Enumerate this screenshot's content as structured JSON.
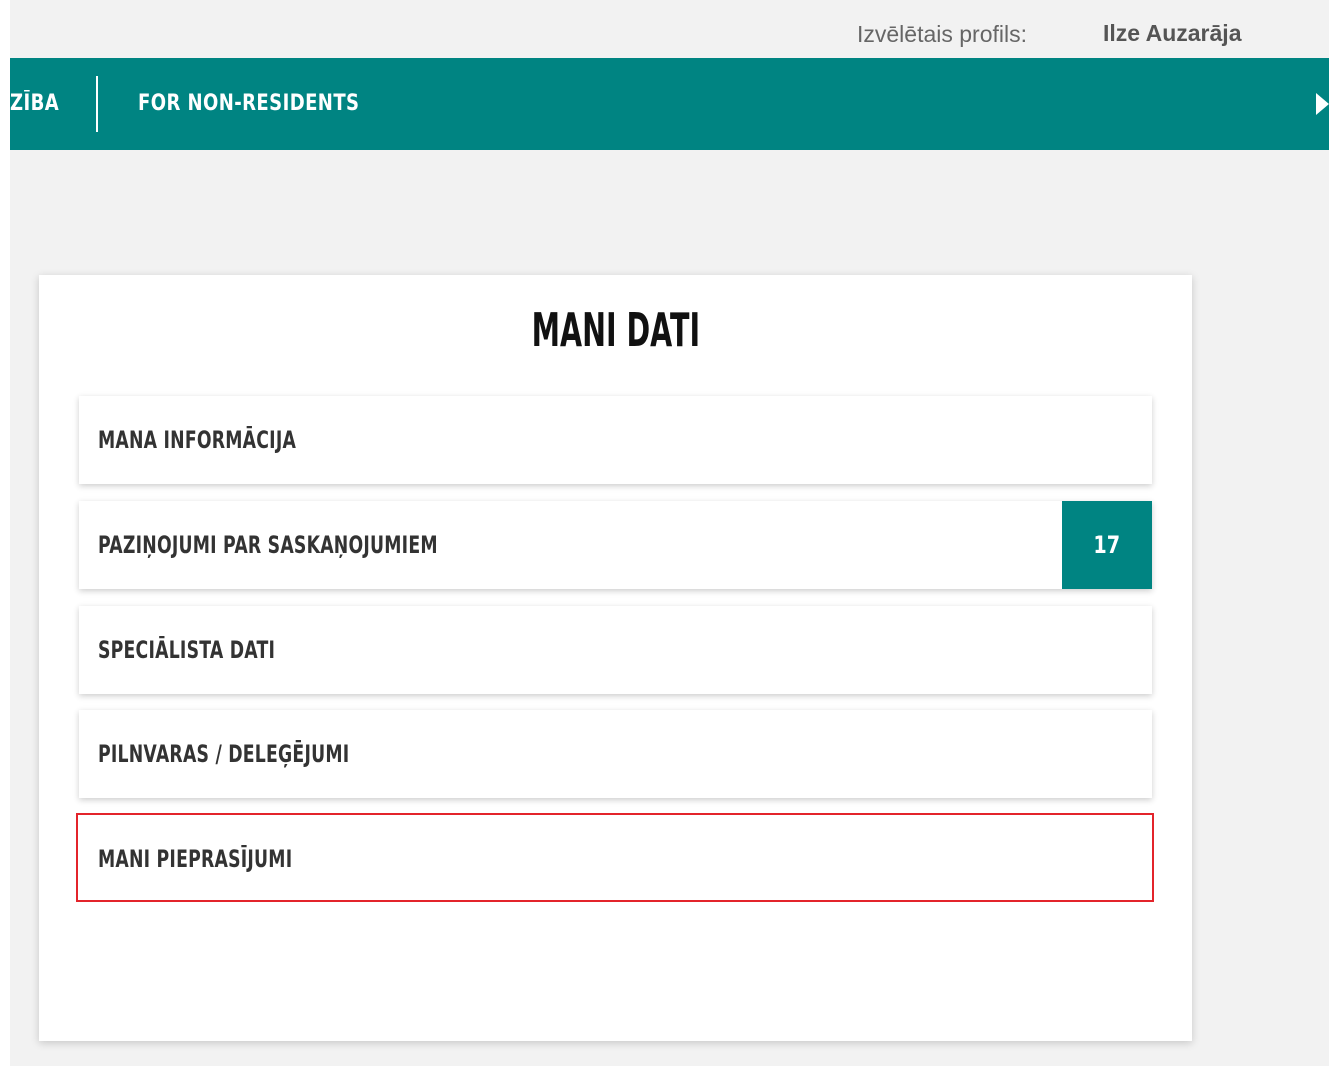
{
  "header": {
    "profile_label": "Izvēlētais profils:",
    "profile_name": "Ilze Auzarāja"
  },
  "nav": {
    "cut_item": "ZĪBA",
    "non_residents": "FOR NON-RESIDENTS",
    "arrow_icon": "triangle-right-icon"
  },
  "card": {
    "title": "MANI DATI",
    "items": [
      {
        "label": "MANA INFORMĀCIJA"
      },
      {
        "label": "PAZIŅOJUMI PAR SASKAŅOJUMIEM",
        "badge": "17"
      },
      {
        "label": "SPECIĀLISTA DATI"
      },
      {
        "label": "PILNVARAS / DELEĢĒJUMI"
      },
      {
        "label": "MANI PIEPRASĪJUMI"
      }
    ]
  },
  "colors": {
    "brand_teal": "#008482",
    "highlight_red": "#e3242b"
  }
}
